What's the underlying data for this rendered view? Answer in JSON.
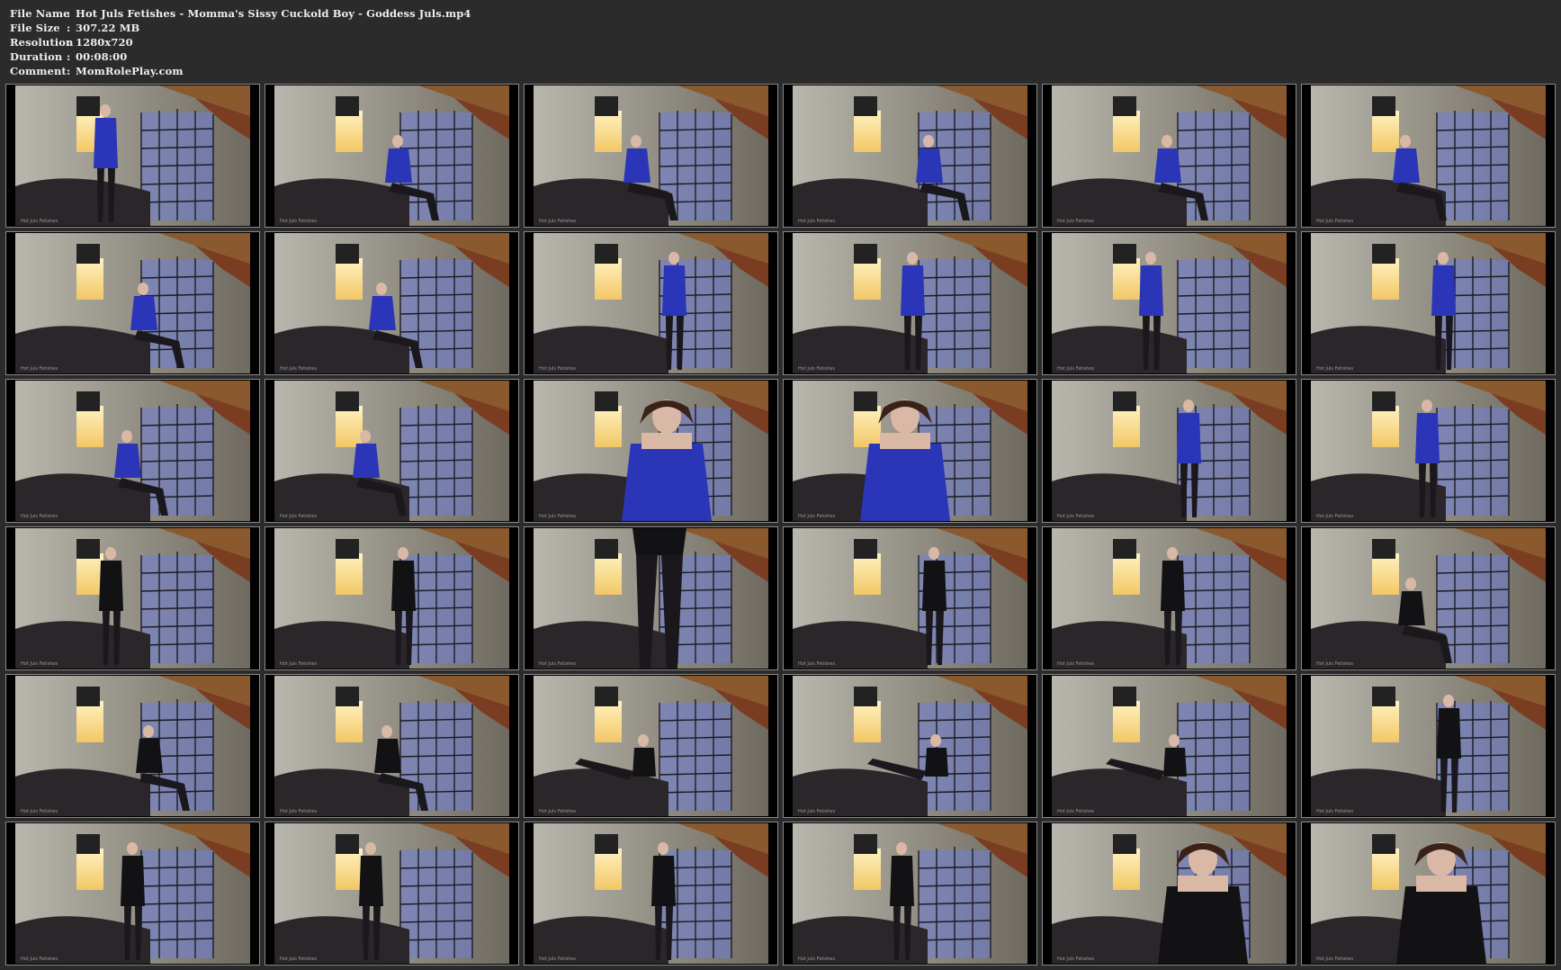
{
  "info": [
    {
      "key": "File Name",
      "sep": ":",
      "value": "Hot Juls Fetishes - Momma's Sissy Cuckold Boy - Goddess Juls.mp4"
    },
    {
      "key": "File Size",
      "sep": ":",
      "value": "307.22 MB"
    },
    {
      "key": "Resolution",
      "sep": ":",
      "value": "1280x720"
    },
    {
      "key": "Duration",
      "sep": ":",
      "value": "00:08:00"
    },
    {
      "key": "Comment",
      "sep": ":",
      "value": "MomRolePlay.com"
    }
  ],
  "watermark": "Hot Juls Fetishes",
  "grid": {
    "columns": 6,
    "rows": 6
  },
  "colors": {
    "background": "#2b2b2b",
    "text": "#eeeeee",
    "thumb_border": "#8a8a8a",
    "wall_light": "#b9b7ad",
    "wall_dark": "#6f6a60",
    "ceiling_wood": "#8a5a2e",
    "window_glow": "#f2c766",
    "screen_blue": "#6f7fd8",
    "couch": "#2a2629",
    "robe_blue": "#2b35b8",
    "outfit_black": "#121214"
  },
  "thumbnails": [
    {
      "outfit": "blue",
      "pose": "standing"
    },
    {
      "outfit": "blue",
      "pose": "sitting"
    },
    {
      "outfit": "blue",
      "pose": "sitting"
    },
    {
      "outfit": "blue",
      "pose": "sitting"
    },
    {
      "outfit": "blue",
      "pose": "sitting"
    },
    {
      "outfit": "blue",
      "pose": "sitting"
    },
    {
      "outfit": "blue",
      "pose": "sitting"
    },
    {
      "outfit": "blue",
      "pose": "sitting"
    },
    {
      "outfit": "blue",
      "pose": "standing"
    },
    {
      "outfit": "blue",
      "pose": "standing"
    },
    {
      "outfit": "blue",
      "pose": "standing"
    },
    {
      "outfit": "blue",
      "pose": "standing"
    },
    {
      "outfit": "blue",
      "pose": "sitting"
    },
    {
      "outfit": "blue",
      "pose": "sitting"
    },
    {
      "outfit": "blue",
      "pose": "closeup"
    },
    {
      "outfit": "blue",
      "pose": "closeup"
    },
    {
      "outfit": "blue",
      "pose": "standing"
    },
    {
      "outfit": "blue",
      "pose": "standing"
    },
    {
      "outfit": "black",
      "pose": "standing"
    },
    {
      "outfit": "black",
      "pose": "standing"
    },
    {
      "outfit": "black",
      "pose": "legs"
    },
    {
      "outfit": "black",
      "pose": "standing"
    },
    {
      "outfit": "black",
      "pose": "standing"
    },
    {
      "outfit": "black",
      "pose": "sitting"
    },
    {
      "outfit": "black",
      "pose": "sitting"
    },
    {
      "outfit": "black",
      "pose": "sitting"
    },
    {
      "outfit": "black",
      "pose": "reclining"
    },
    {
      "outfit": "black",
      "pose": "reclining"
    },
    {
      "outfit": "black",
      "pose": "reclining"
    },
    {
      "outfit": "black",
      "pose": "standing"
    },
    {
      "outfit": "black",
      "pose": "standing"
    },
    {
      "outfit": "black",
      "pose": "standing"
    },
    {
      "outfit": "black",
      "pose": "standing"
    },
    {
      "outfit": "black",
      "pose": "standing"
    },
    {
      "outfit": "black",
      "pose": "closeup"
    },
    {
      "outfit": "black",
      "pose": "closeup"
    }
  ]
}
